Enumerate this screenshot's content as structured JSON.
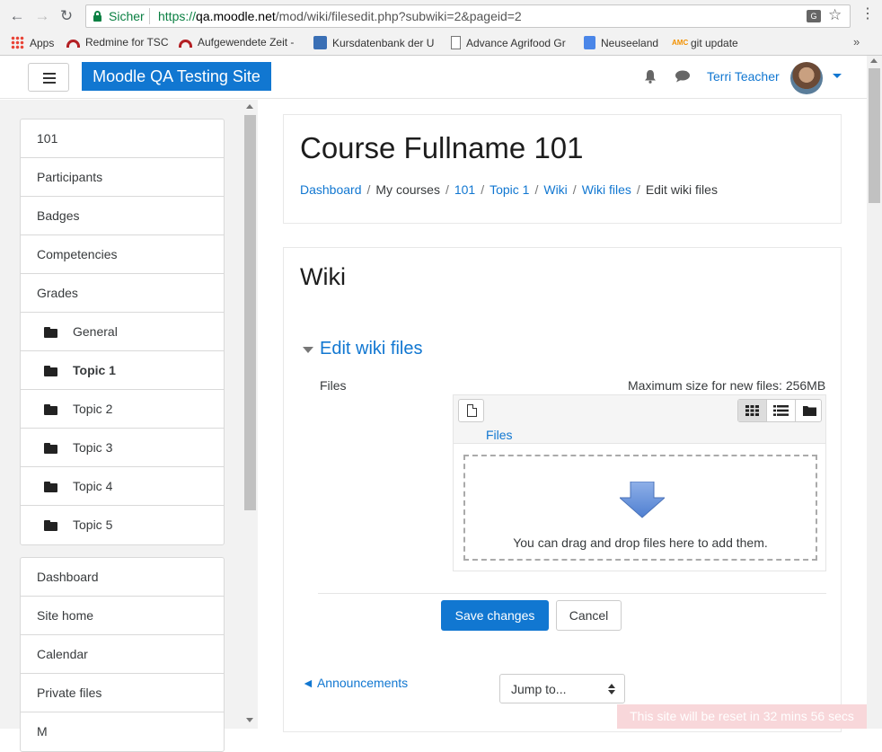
{
  "browser": {
    "secure_label": "Sicher",
    "url_scheme": "https://",
    "url_host": "qa.moodle.net",
    "url_path": "/mod/wiki/filesedit.php?subwiki=2&pageid=2",
    "bookmarks": [
      {
        "label": "Apps",
        "icon": "apps-grid-icon"
      },
      {
        "label": "Redmine for TSC",
        "icon": "redmine-icon"
      },
      {
        "label": "Aufgewendete Zeit -",
        "icon": "redmine-icon"
      },
      {
        "label": "Kursdatenbank der U",
        "icon": "globe-icon"
      },
      {
        "label": "Advance Agrifood Gr",
        "icon": "page-icon"
      },
      {
        "label": "Neuseeland",
        "icon": "docs-icon"
      },
      {
        "label": "git update",
        "icon": "amc-icon"
      }
    ],
    "more": "»"
  },
  "navbar": {
    "site_name": "Moodle QA Testing Site",
    "user_name": "Terri Teacher"
  },
  "drawer": {
    "course_items": [
      {
        "label": "101"
      },
      {
        "label": "Participants"
      },
      {
        "label": "Badges"
      },
      {
        "label": "Competencies"
      },
      {
        "label": "Grades"
      },
      {
        "label": "General"
      },
      {
        "label": "Topic 1"
      },
      {
        "label": "Topic 2"
      },
      {
        "label": "Topic 3"
      },
      {
        "label": "Topic 4"
      },
      {
        "label": "Topic 5"
      }
    ],
    "site_items": [
      {
        "label": "Dashboard"
      },
      {
        "label": "Site home"
      },
      {
        "label": "Calendar"
      },
      {
        "label": "Private files"
      },
      {
        "label": "M"
      }
    ]
  },
  "header": {
    "course_title": "Course Fullname 101",
    "breadcrumb": [
      "Dashboard",
      "My courses",
      "101",
      "Topic 1",
      "Wiki",
      "Wiki files",
      "Edit wiki files"
    ]
  },
  "main": {
    "title": "Wiki",
    "section_legend": "Edit wiki files",
    "files_label": "Files",
    "max_size": "Maximum size for new files: 256MB",
    "path_label": "Files",
    "drop_text": "You can drag and drop files here to add them.",
    "save_label": "Save changes",
    "cancel_label": "Cancel",
    "prev_link": "◄ Announcements",
    "jump_to": "Jump to..."
  },
  "footer": {
    "reset_notice": "This site will be reset in 32 mins 56 secs"
  },
  "colors": {
    "brand": "#1177d1",
    "secure": "#0b8043"
  }
}
